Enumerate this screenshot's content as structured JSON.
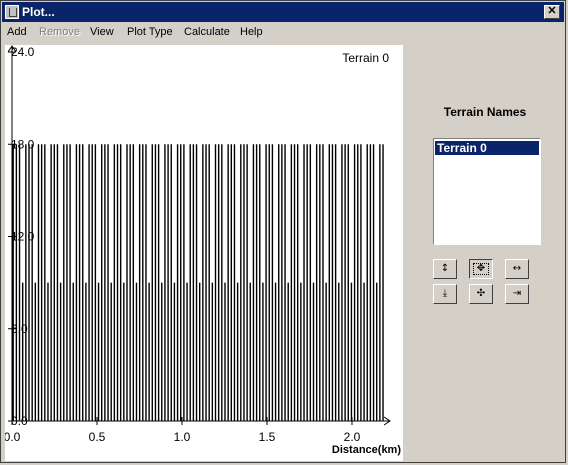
{
  "window": {
    "title": "Plot..."
  },
  "menu": [
    {
      "label": "Add",
      "enabled": true
    },
    {
      "label": "Remove",
      "enabled": false
    },
    {
      "label": "View",
      "enabled": true
    },
    {
      "label": "Plot Type",
      "enabled": true
    },
    {
      "label": "Calculate",
      "enabled": true
    },
    {
      "label": "Help",
      "enabled": true
    }
  ],
  "panel": {
    "title": "Terrain Names",
    "items": [
      "Terrain 0"
    ],
    "buttons": [
      {
        "name": "stretch-vertical-button",
        "glyph": "↕"
      },
      {
        "name": "pan-all-button",
        "glyph": "✥"
      },
      {
        "name": "stretch-horizontal-button",
        "glyph": "↔"
      },
      {
        "name": "compress-vertical-button",
        "glyph": "⤓"
      },
      {
        "name": "compress-all-button",
        "glyph": "✣"
      },
      {
        "name": "compress-horizontal-button",
        "glyph": "⇥"
      }
    ]
  },
  "chart_data": {
    "type": "bar",
    "legend": "Terrain 0",
    "xlabel": "Distance(km)",
    "ylabel": "",
    "xlim": [
      0,
      2.1
    ],
    "ylim": [
      0,
      24
    ],
    "xticks": [
      "0.0",
      "0.5",
      "1.0",
      "1.5",
      "2.0"
    ],
    "yticks": [
      "0.0",
      "6.0",
      "12.0",
      "18.0",
      "24.0"
    ],
    "bar_count": 118,
    "bar_height_pattern": [
      18,
      18,
      18,
      9
    ],
    "bar_color": "#000000"
  }
}
